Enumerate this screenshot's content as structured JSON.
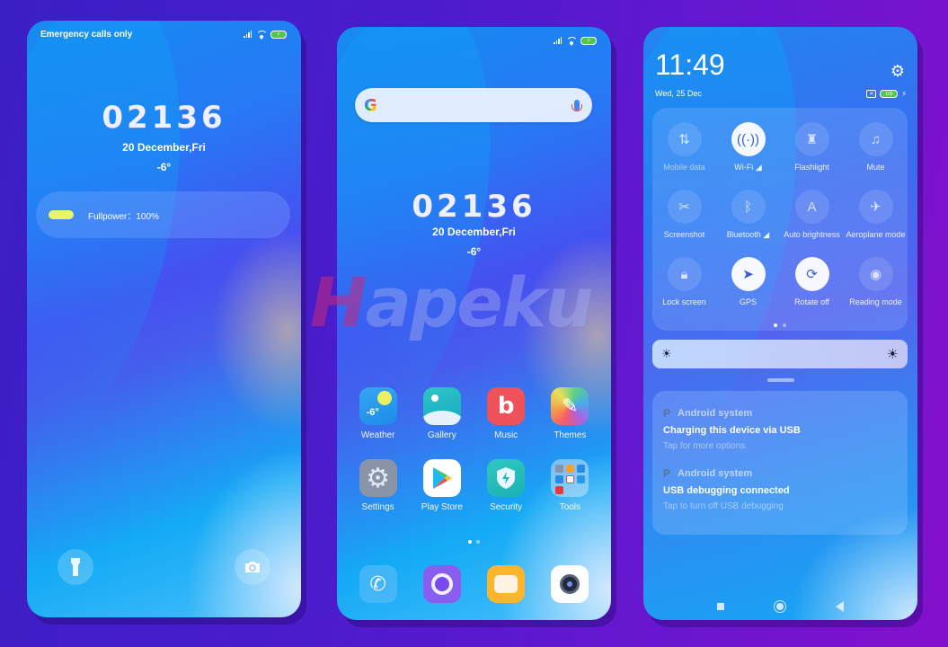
{
  "lock_screen": {
    "status": {
      "carrier_text": "Emergency calls only"
    },
    "clock": {
      "time": "02136",
      "date": "20 December,Fri",
      "temperature": "-6°"
    },
    "power": {
      "label": "Fullpower：100%",
      "level_percent": 100
    },
    "shortcuts": [
      {
        "name": "flashlight",
        "icon": "▮"
      },
      {
        "name": "camera",
        "icon": "◉"
      }
    ]
  },
  "home_screen": {
    "search": {
      "logo": "G",
      "placeholder": ""
    },
    "clock": {
      "time": "02136",
      "date": "20 December,Fri",
      "temperature": "-6°"
    },
    "apps": [
      {
        "label": "Weather",
        "glyph": "-6°"
      },
      {
        "label": "Gallery",
        "glyph": ""
      },
      {
        "label": "Music",
        "glyph": "b"
      },
      {
        "label": "Themes",
        "glyph": "✎"
      },
      {
        "label": "Settings",
        "glyph": "⚙"
      },
      {
        "label": "Play Store",
        "glyph": "▶"
      },
      {
        "label": "Security",
        "glyph": "⚡"
      },
      {
        "label": "Tools",
        "glyph": ""
      }
    ],
    "dock": [
      {
        "name": "phone",
        "glyph": "✆"
      },
      {
        "name": "browser",
        "glyph": "○"
      },
      {
        "name": "messages",
        "glyph": "▬"
      },
      {
        "name": "camera",
        "glyph": "◉"
      }
    ],
    "page_count": 2,
    "active_page": 1
  },
  "notification_shade": {
    "time": "11:49",
    "date": "Wed, 25 Dec",
    "battery_text": "100",
    "quick_settings": [
      {
        "label": "Mobile data",
        "icon": "⇅",
        "on": false,
        "dim": true
      },
      {
        "label": "Wi-Fi ◢",
        "icon": "((·))",
        "on": true,
        "dim": false
      },
      {
        "label": "Flashlight",
        "icon": "♜",
        "on": false,
        "dim": false
      },
      {
        "label": "Mute",
        "icon": "♫",
        "on": false,
        "dim": false
      },
      {
        "label": "Screenshot",
        "icon": "✂",
        "on": false,
        "dim": false
      },
      {
        "label": "Bluetooth ◢",
        "icon": "ᛒ",
        "on": false,
        "dim": false
      },
      {
        "label": "Auto brightness",
        "icon": "A",
        "on": false,
        "dim": false
      },
      {
        "label": "Aeroplane mode",
        "icon": "✈",
        "on": false,
        "dim": false
      },
      {
        "label": "Lock screen",
        "icon": "🔒︎",
        "on": false,
        "dim": false
      },
      {
        "label": "GPS",
        "icon": "➤",
        "on": true,
        "dim": false
      },
      {
        "label": "Rotate off",
        "icon": "⟳",
        "on": true,
        "dim": false
      },
      {
        "label": "Reading mode",
        "icon": "◉",
        "on": false,
        "dim": false
      }
    ],
    "brightness_icons": {
      "low": "☀",
      "high": "☀"
    },
    "notifications": [
      {
        "app": "Android system",
        "title": "Charging this device via USB",
        "body": "Tap for more options."
      },
      {
        "app": "Android system",
        "title": "USB debugging connected",
        "body": "Tap to turn off USB debugging"
      }
    ]
  },
  "watermark": {
    "text": "apeku",
    "prefix": "H"
  }
}
